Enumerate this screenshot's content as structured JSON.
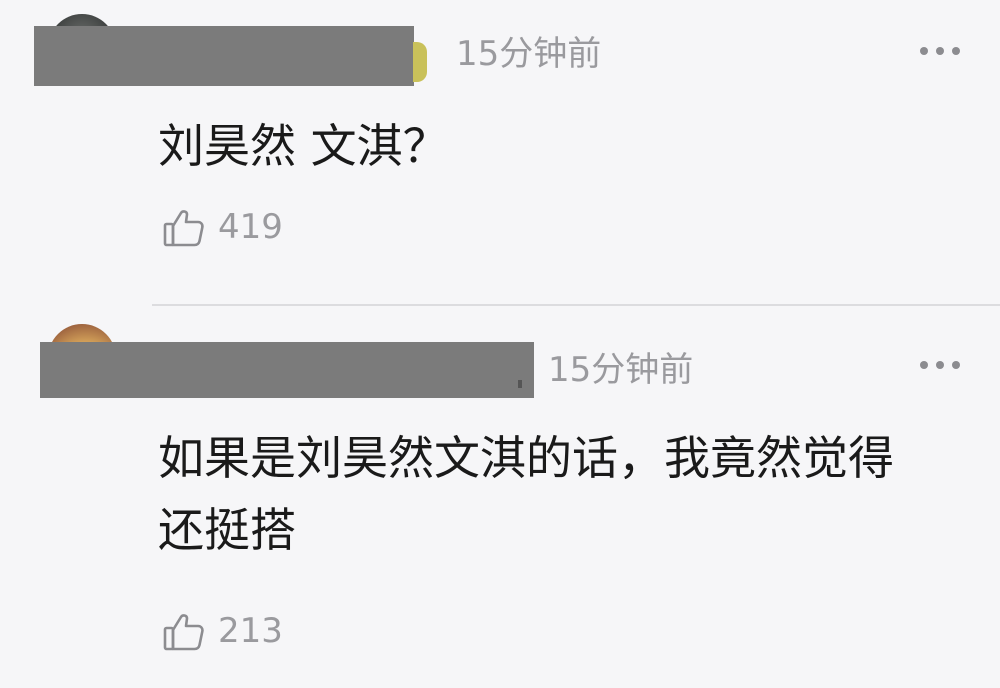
{
  "comments": [
    {
      "time": "15分钟前",
      "text": "刘昊然 文淇？",
      "likes": "419",
      "more_icon": "more-dots-icon",
      "like_icon": "thumbs-up-icon"
    },
    {
      "time": "15分钟前",
      "text": "如果是刘昊然文淇的话，我竟然觉得还挺搭",
      "likes": "213",
      "more_icon": "more-dots-icon",
      "like_icon": "thumbs-up-icon"
    }
  ],
  "colors": {
    "background": "#f6f6f8",
    "meta_text": "#9a9a9e",
    "body_text": "#1a1a1a",
    "redaction": "#7b7b7b",
    "divider": "#dcdcdf"
  }
}
